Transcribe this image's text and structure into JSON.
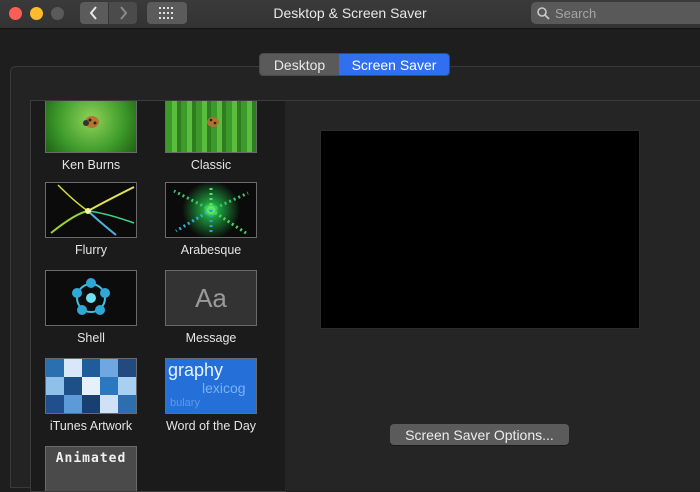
{
  "window": {
    "title": "Desktop & Screen Saver",
    "search_placeholder": "Search"
  },
  "tabs": [
    {
      "label": "Desktop",
      "selected": false
    },
    {
      "label": "Screen Saver",
      "selected": true
    }
  ],
  "savers": [
    {
      "name": "Ken Burns",
      "icon": "ladybug-leaf-image"
    },
    {
      "name": "Classic",
      "icon": "ladybug-leaf-image"
    },
    {
      "name": "Flurry",
      "icon": "flurry-streaks-image"
    },
    {
      "name": "Arabesque",
      "icon": "arabesque-dots-image"
    },
    {
      "name": "Shell",
      "icon": "shell-flower-image"
    },
    {
      "name": "Message",
      "icon": "aa-text-image",
      "thumb_text": "Aa"
    },
    {
      "name": "iTunes Artwork",
      "icon": "album-grid-image"
    },
    {
      "name": "Word of the Day",
      "icon": "word-cloud-image",
      "thumb_words": [
        "graphy",
        "lexicog",
        "bulary"
      ]
    },
    {
      "name": "",
      "icon": "animated-gif-image",
      "thumb_text": "Animated"
    }
  ],
  "options_button": "Screen Saver Options..."
}
